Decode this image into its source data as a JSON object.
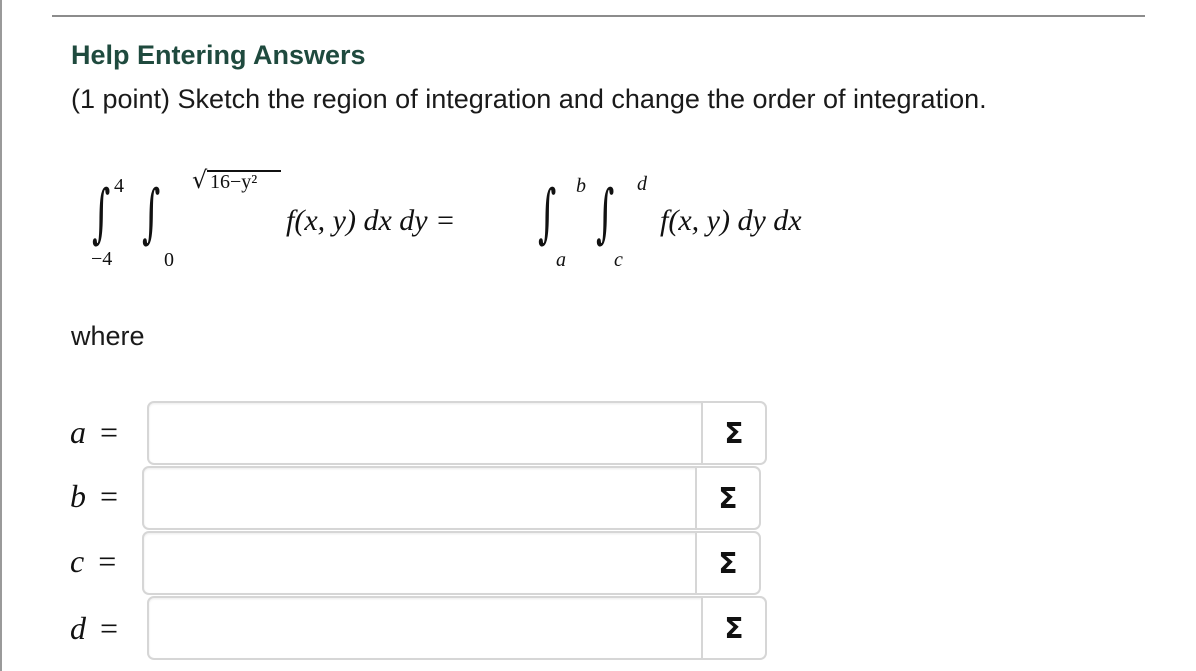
{
  "header": {
    "help_link": "Help Entering Answers",
    "problem_text": "(1 point) Sketch the region of integration and change the order of integration."
  },
  "equation": {
    "lhs": {
      "outer_upper": "4",
      "outer_lower": "−4",
      "inner_upper": "16−y²",
      "inner_lower": "0",
      "integrand": "f(x, y) dx dy ="
    },
    "rhs": {
      "outer_upper": "b",
      "outer_lower": "a",
      "inner_upper": "d",
      "inner_lower": "c",
      "integrand": "f(x, y) dy dx"
    }
  },
  "where_label": "where",
  "answers": [
    {
      "variable": "a",
      "equals": "=",
      "value": "",
      "button_icon": "sigma-icon",
      "button_glyph": "Σ"
    },
    {
      "variable": "b",
      "equals": "=",
      "value": "",
      "button_icon": "sigma-icon",
      "button_glyph": "Σ"
    },
    {
      "variable": "c",
      "equals": "=",
      "value": "",
      "button_icon": "sigma-icon",
      "button_glyph": "Σ"
    },
    {
      "variable": "d",
      "equals": "=",
      "value": "",
      "button_icon": "sigma-icon",
      "button_glyph": "Σ"
    }
  ],
  "colors": {
    "help_link": "#1f4a3e",
    "input_border": "#d6d6d6"
  }
}
